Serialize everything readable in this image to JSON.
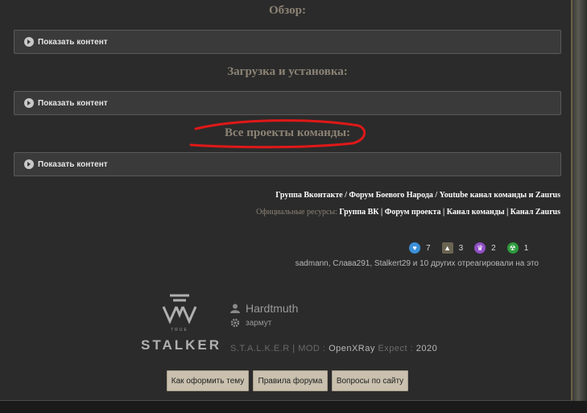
{
  "sections": [
    {
      "heading": "Обзор:",
      "spoiler_label": "Показать контент"
    },
    {
      "heading": "Загрузка и установка:",
      "spoiler_label": "Показать контент"
    },
    {
      "heading": "Все проекты команды:",
      "spoiler_label": "Показать контент"
    }
  ],
  "links": {
    "line1": {
      "vk": "Группа Вконтакте",
      "sep1": " / ",
      "forum": "Форум Боевого Народа",
      "sep2": " / ",
      "youtube": "Youtube канал команды и Zaurus"
    },
    "line2": {
      "label": "Официальные ресурсы: ",
      "vk": "Группа ВК",
      "sep1": " | ",
      "forum": "Форум проекта",
      "sep2": " | ",
      "channel": "Канал команды",
      "sep3": " | ",
      "zaurus": "Канал Zaurus"
    }
  },
  "reactions": {
    "items": [
      {
        "icon": "heart-icon",
        "count": "7",
        "color": "#3a8fd8"
      },
      {
        "icon": "thumbs-up-icon",
        "count": "3",
        "color": "#6a6452"
      },
      {
        "icon": "trophy-icon",
        "count": "2",
        "color": "#8f4fc4"
      },
      {
        "icon": "radiation-icon",
        "count": "1",
        "color": "#2d9a3e"
      }
    ],
    "reacted_by": "sadmann, Слава291, Stalkert29 и 10 других отреагировали на это"
  },
  "signature": {
    "logo_small": "TRUE",
    "logo_word": "STALKER",
    "author": "Hardtmuth",
    "status": "зармут",
    "line_prefix": "S.T.A.L.K.E.R | MOD : ",
    "engine": "OpenXRay",
    "expect_label": " Expect : ",
    "year": "2020"
  },
  "buttons": {
    "theme": "Как оформить тему",
    "rules": "Правила форума",
    "questions": "Вопросы по сайту"
  },
  "colors": {
    "panel": "#2b2b2b",
    "heading": "#8c8375",
    "spoiler_bg": "#3a3a3a",
    "button_bg": "#c9c0ae",
    "annotation": "#e01818"
  }
}
